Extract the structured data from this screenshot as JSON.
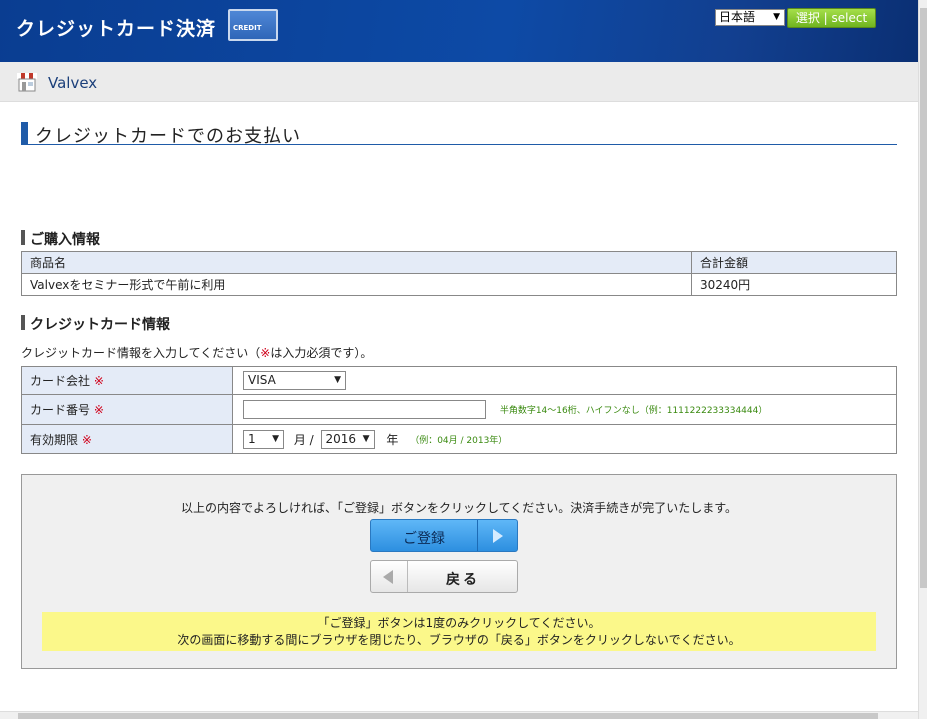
{
  "header": {
    "title": "クレジットカード決済",
    "card_badge": "CREDIT",
    "language": "日本語",
    "select_button": "選択 | select"
  },
  "shop": {
    "name": "Valvex"
  },
  "page_title": "クレジットカードでのお支払い",
  "purchase": {
    "heading": "ご購入情報",
    "col_product": "商品名",
    "col_total": "合計金額",
    "product": "Valvexをセミナー形式で午前に利用",
    "total": "30240円"
  },
  "card": {
    "heading": "クレジットカード情報",
    "intro_before": "クレジットカード情報を入力してください（",
    "intro_mark": "※",
    "intro_after": "は入力必須です）。",
    "required_mark": "※",
    "company_label": "カード会社",
    "company_value": "VISA",
    "number_label": "カード番号",
    "number_value": "",
    "number_hint": "半角数字14〜16桁、ハイフンなし（例：1111222233334444）",
    "expiry_label": "有効期限",
    "expiry_month": "1",
    "month_unit": "月 /",
    "expiry_year": "2016",
    "year_unit": "年",
    "expiry_hint": "（例：04月 / 2013年）"
  },
  "confirm": {
    "message": "以上の内容でよろしければ、「ご登録」ボタンをクリックしてください。決済手続きが完了いたします。",
    "register_button": "ご登録",
    "back_button": "戻る",
    "notice_line1": "「ご登録」ボタンは1度のみクリックしてください。",
    "notice_line2": "次の画面に移動する間にブラウザを閉じたり、ブラウザの「戻る」ボタンをクリックしないでください。"
  },
  "colors": {
    "header_blue": "#0d4aa6",
    "accent_blue": "#1f5ba8",
    "select_green": "#6fb41f",
    "required_red": "#d0021b",
    "hint_green": "#3a8a10",
    "notice_yellow": "#fbf88a"
  },
  "icons": {
    "shop": "shop-awning-icon",
    "dropdown": "dropdown-arrow-icon",
    "next": "arrow-right-icon",
    "back": "arrow-left-icon"
  }
}
